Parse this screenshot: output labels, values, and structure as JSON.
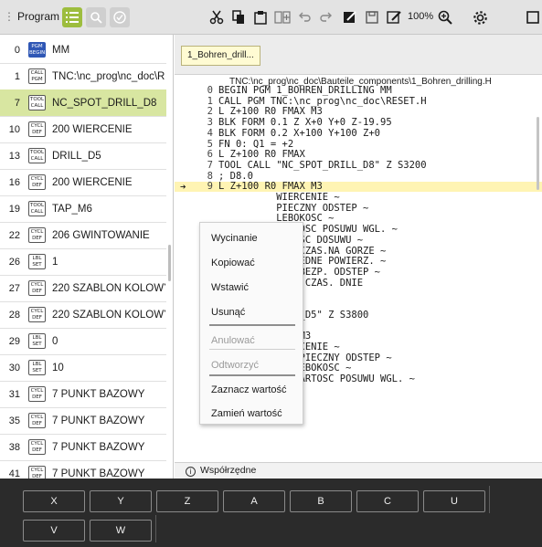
{
  "topbar": {
    "program_label": "Program",
    "zoom": "100%",
    "icons": [
      "list-icon",
      "search-icon",
      "check-circle-icon",
      "cut-icon",
      "copy-icon",
      "paste-icon",
      "insert-icon",
      "undo-icon",
      "redo-icon",
      "edit-icon",
      "save-icon",
      "save-as-icon",
      "zoom-icon",
      "settings-icon",
      "window-icon"
    ]
  },
  "program_list": [
    {
      "num": "0",
      "badge": [
        "PGM",
        "BEGIN"
      ],
      "badge_style": "blue",
      "text": "MM"
    },
    {
      "num": "1",
      "badge": [
        "CALL",
        "PGM"
      ],
      "text": "TNC:\\nc_prog\\nc_doc\\RESET"
    },
    {
      "num": "7",
      "badge": [
        "TOOL",
        "CALL"
      ],
      "text": "NC_SPOT_DRILL_D8",
      "active": true
    },
    {
      "num": "10",
      "badge": [
        "CYCL",
        "DEF"
      ],
      "text": "200 WIERCENIE"
    },
    {
      "num": "13",
      "badge": [
        "TOOL",
        "CALL"
      ],
      "text": "DRILL_D5"
    },
    {
      "num": "16",
      "badge": [
        "CYCL",
        "DEF"
      ],
      "text": "200 WIERCENIE"
    },
    {
      "num": "19",
      "badge": [
        "TOOL",
        "CALL"
      ],
      "text": "TAP_M6"
    },
    {
      "num": "22",
      "badge": [
        "CYCL",
        "DEF"
      ],
      "text": "206 GWINTOWANIE"
    },
    {
      "num": "26",
      "badge": [
        "LBL",
        "SET"
      ],
      "text": "1"
    },
    {
      "num": "27",
      "badge": [
        "CYCL",
        "DEF"
      ],
      "text": "220 SZABLON KOLOWY"
    },
    {
      "num": "28",
      "badge": [
        "CYCL",
        "DEF"
      ],
      "text": "220 SZABLON KOLOWY"
    },
    {
      "num": "29",
      "badge": [
        "LBL",
        "SET"
      ],
      "text": "0"
    },
    {
      "num": "30",
      "badge": [
        "LBL",
        "SET"
      ],
      "text": "10"
    },
    {
      "num": "31",
      "badge": [
        "CYCL",
        "DEF"
      ],
      "text": "7 PUNKT BAZOWY"
    },
    {
      "num": "35",
      "badge": [
        "CYCL",
        "DEF"
      ],
      "text": "7 PUNKT BAZOWY"
    },
    {
      "num": "38",
      "badge": [
        "CYCL",
        "DEF"
      ],
      "text": "7 PUNKT BAZOWY"
    },
    {
      "num": "41",
      "badge": [
        "CYCL",
        "DEF"
      ],
      "text": "7 PUNKT BAZOWY"
    },
    {
      "num": "44",
      "badge": [
        "CYCL",
        "DEF"
      ],
      "text": "7 PUNKT BAZOWY"
    }
  ],
  "editor": {
    "tab_label": "1_Bohren_drill...",
    "file_path": "TNC:\\nc_prog\\nc_doc\\Bauteile_components\\1_Bohren_drilling.H",
    "status_label": "Współrzędne",
    "lines": [
      {
        "ln": "0",
        "text": "BEGIN PGM 1_BOHREN_DRILLING MM"
      },
      {
        "ln": "1",
        "text": "CALL PGM TNC:\\nc_prog\\nc_doc\\RESET.H"
      },
      {
        "ln": "2",
        "text": "L Z+100 R0 FMAX M3"
      },
      {
        "ln": "3",
        "text": "BLK FORM 0.1 Z X+0 Y+0 Z-19.95"
      },
      {
        "ln": "4",
        "text": "BLK FORM 0.2 X+100 Y+100 Z+0"
      },
      {
        "ln": "5",
        "text": "FN 0: Q1 = +2"
      },
      {
        "ln": "6",
        "text": "L Z+100 R0 FMAX"
      },
      {
        "ln": "7",
        "text": "TOOL CALL \"NC_SPOT_DRILL_D8\" Z S3200"
      },
      {
        "ln": "8",
        "text": "; D8.0"
      },
      {
        "ln": "9",
        "text": "L Z+100 R0 FMAX M3",
        "current": true
      },
      {
        "ln": "",
        "text": "          WIERCENIE ~"
      },
      {
        "ln": "",
        "text": "          PIECZNY ODSTEP ~"
      },
      {
        "ln": "",
        "text": "          LEBOKOSC ~"
      },
      {
        "ln": "",
        "text": "          WARTOSC POSUWU WGL. ~"
      },
      {
        "ln": "",
        "text": "          BOKOSC DOSUWU ~"
      },
      {
        "ln": "",
        "text": "          ER. CZAS.NA GORZE ~"
      },
      {
        "ln": "",
        "text": "          OLRZEDNE POWIERZ. ~"
      },
      {
        "ln": "",
        "text": "          UGI BEZP. ODSTEP ~"
      },
      {
        "ln": "",
        "text": "          ERWA CZAS. DNIE"
      },
      {
        "ln": "",
        "text": ""
      },
      {
        "ln": "",
        "text": "          MAX"
      },
      {
        "ln": "",
        "text": "          RILL_D5\" Z S3800"
      },
      {
        "ln": "",
        "text": ""
      },
      {
        "ln": "",
        "text": "          MAX M3"
      },
      {
        "ln": "",
        "text": "          WIERCENIE ~"
      },
      {
        "ln": "",
        "text": "  Q200=+2 ;BEZPIECZNY ODSTEP ~"
      },
      {
        "ln": "",
        "text": "  Q201=-16 ;GLEBOKOSC ~"
      },
      {
        "ln": "",
        "text": "  Q206=+350 ;WARTOSC POSUWU WGL. ~"
      }
    ]
  },
  "context_menu": {
    "items": [
      {
        "label": "Wycinanie",
        "enabled": true
      },
      {
        "label": "Kopiować",
        "enabled": true
      },
      {
        "label": "Wstawić",
        "enabled": true
      },
      {
        "label": "Usunąć",
        "enabled": true
      },
      {
        "label": "Anulować",
        "enabled": false
      },
      {
        "label": "Odtworzyć",
        "enabled": false
      },
      {
        "label": "Zaznacz wartość",
        "enabled": true
      },
      {
        "label": "Zamień wartość",
        "enabled": true
      }
    ]
  },
  "keyboard": {
    "row1": [
      "X",
      "Y",
      "Z",
      "A",
      "B",
      "C",
      "U"
    ],
    "row2": [
      "V",
      "W"
    ]
  },
  "colors": {
    "accent_green": "#9dbd3e",
    "active_row": "#d8e6a1",
    "current_line": "#fff4b3",
    "tab_bg": "#fffbd3",
    "keyboard_bg": "#2b2b2b"
  }
}
